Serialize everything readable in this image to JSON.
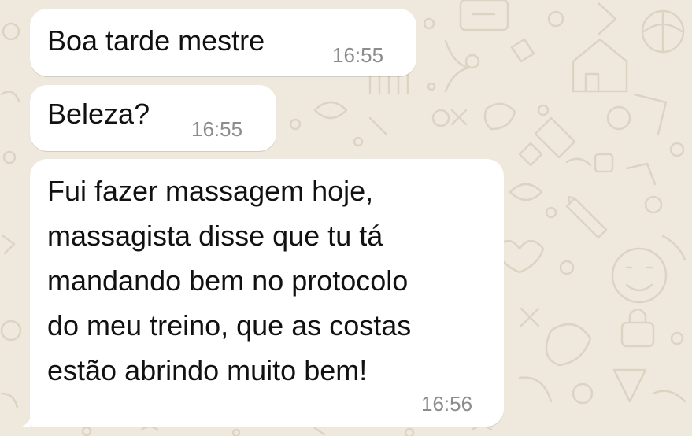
{
  "messages": [
    {
      "text": "Boa tarde mestre",
      "time": "16:55"
    },
    {
      "text": "Beleza?",
      "time": "16:55"
    },
    {
      "lines": [
        "Fui fazer massagem hoje,",
        "massagista disse que tu tá",
        "mandando bem no protocolo",
        "do meu treino, que as costas",
        "estão abrindo muito bem!"
      ],
      "time": "16:56"
    }
  ],
  "colors": {
    "wallpaper": "#efe9dd",
    "doodle": "#dcd3c3",
    "bubble": "#ffffff",
    "text": "#111111",
    "timestamp": "#8c8c8c"
  }
}
